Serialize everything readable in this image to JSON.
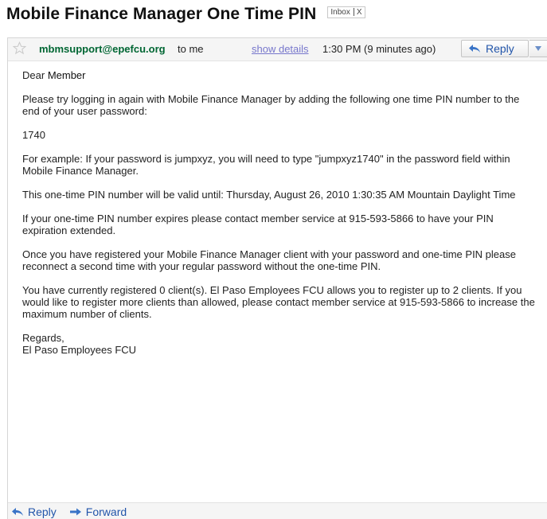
{
  "subject": {
    "title": "Mobile Finance Manager One Time PIN",
    "label": "Inbox",
    "label_remove": "X"
  },
  "header": {
    "sender": "mbmsupport@epefcu.org",
    "recipient": "to me",
    "show_details": "show details",
    "time": "1:30 PM (9 minutes ago)",
    "reply_label": "Reply"
  },
  "body": {
    "greeting_prefix": "Dear",
    "greeting_name": "Member",
    "p1": "Please try logging in again with Mobile Finance Manager by adding the following one time PIN number to the end of your user password:",
    "pin": "1740",
    "p2": "For example: If your password is jumpxyz, you will need to type \"jumpxyz1740\" in the password field within Mobile Finance Manager.",
    "p3": "This one-time PIN number will be valid until: Thursday, August 26, 2010 1:30:35 AM Mountain Daylight Time",
    "p4": "If your one-time PIN number expires please contact member service at 915-593-5866 to have your PIN expiration extended.",
    "p5": "Once you have registered your Mobile Finance Manager client with your password and one-time PIN please reconnect a second time with your regular password without the one-time PIN.",
    "p6": "You have currently registered 0 client(s). El Paso Employees FCU allows you to register up to 2 clients. If you would like to register more clients than allowed, please contact member service at 915-593-5866 to increase the maximum number of clients.",
    "regards": "Regards,",
    "signature": "El Paso Employees FCU"
  },
  "footer": {
    "reply_label": "Reply",
    "forward_label": "Forward"
  },
  "icons": {
    "star": "star-icon",
    "reply": "reply-arrow-icon",
    "forward": "forward-arrow-icon",
    "more": "dropdown-triangle-icon"
  },
  "colors": {
    "sender": "#006633",
    "link": "#2255aa",
    "show_details": "#7777cc"
  }
}
